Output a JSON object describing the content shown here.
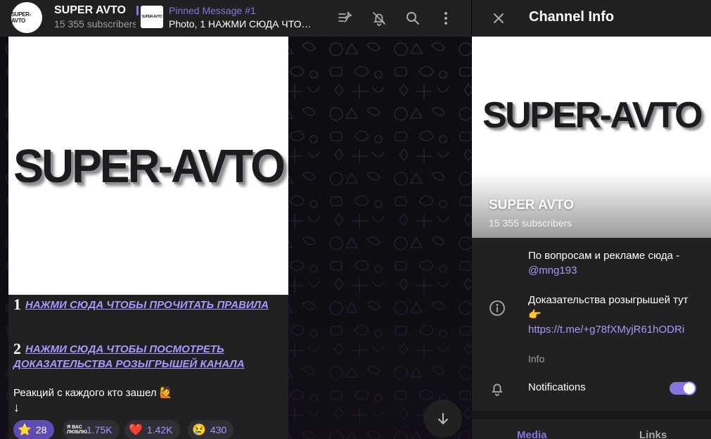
{
  "header": {
    "channel_name": "SUPER AVTO",
    "subscribers": "15 355 subscribers",
    "avatar_text": "SUPER-AVTO",
    "pinned_title": "Pinned Message #1",
    "pinned_text": "Photo, 1 НАЖМИ СЮДА ЧТО…",
    "pinned_thumb_text": "SUPER-AVTO"
  },
  "message": {
    "photo_logo": "SUPER-AVTO",
    "line1_num": "1",
    "line1_link": "НАЖМИ СЮДА ЧТОБЫ ПРОЧИТАТЬ ПРАВИЛА",
    "line2_num": "2",
    "line2_link_a": "НАЖМИ СЮДА ЧТОБЫ ПОСМОТРЕТЬ",
    "line2_link_b": "ДОКАЗАТЕЛЬСТВА РОЗЫГРЫШЕЙ КАНАЛА",
    "reaction_text": "Реакций с каждого кто зашел 🙋",
    "arrow": "↓",
    "reactions": [
      {
        "emoji": "⭐",
        "count": "28"
      },
      {
        "emoji": "Я ВАС ЛЮБЛЮ",
        "count": "1.75K"
      },
      {
        "emoji": "❤️",
        "count": "1.42K"
      },
      {
        "emoji": "😢",
        "count": "430"
      }
    ]
  },
  "panel": {
    "title": "Channel Info",
    "banner_logo": "SUPER-AVTO",
    "name": "SUPER AVTO",
    "subscribers": "15 355 subscribers",
    "desc_line": "По вопросам и рекламе сюда -",
    "desc_handle": "@mng193",
    "proof_text": "Доказательства розыгрышей тут 👉",
    "proof_link": "https://t.me/+g78fXMyjR61hODRi",
    "info_label": "Info",
    "notifications_label": "Notifications",
    "notifications_on": true,
    "tabs": [
      "Media",
      "Links"
    ]
  },
  "colors": {
    "accent": "#8774e1",
    "link": "#a898ff",
    "surface": "#212121",
    "background": "#181818"
  }
}
